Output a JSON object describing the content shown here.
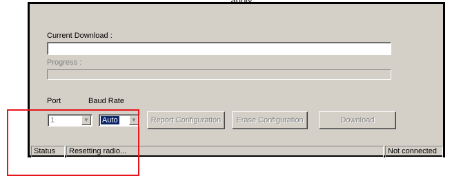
{
  "top_caption": "apply",
  "main": {
    "current_download_label": "Current Download :",
    "current_download_value": "",
    "progress_label": "Progress :",
    "progress": 0
  },
  "controls": {
    "port_label": "Port",
    "port_value": "1",
    "baud_rate_label": "Baud Rate",
    "baud_rate_value": "Auto",
    "report_button": "Report Configuration",
    "erase_button": "Erase Configuration",
    "download_button": "Download"
  },
  "statusbar": {
    "status_label": "Status",
    "message": "Resetting radio...",
    "connection": "Not connected"
  },
  "icons": {
    "combo_arrow": "chevron-down-icon"
  },
  "colors": {
    "window_bg": "#d4d0c8",
    "highlight": "#e8141c",
    "selection": "#0a246a"
  }
}
